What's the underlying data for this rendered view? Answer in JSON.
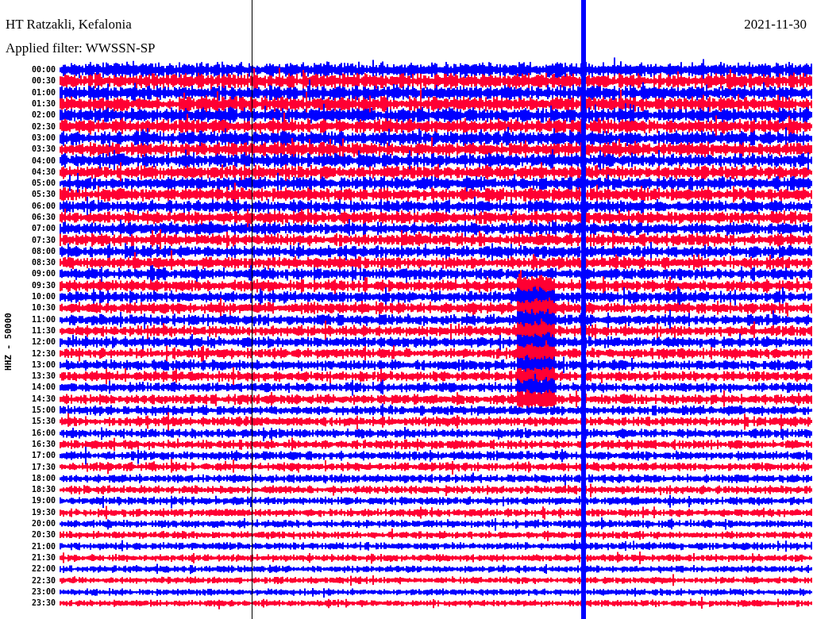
{
  "header": {
    "station": "HT Ratzakli, Kefalonia",
    "date": "2021-11-30",
    "filter": "Applied filter: WWSSN-SP"
  },
  "axis_label": "HHZ - 50000",
  "traces": [
    {
      "time": "00:00",
      "color": "#0000ff"
    },
    {
      "time": "00:30",
      "color": "#ff0033"
    },
    {
      "time": "01:00",
      "color": "#0000ff"
    },
    {
      "time": "01:30",
      "color": "#ff0033"
    },
    {
      "time": "02:00",
      "color": "#0000ff"
    },
    {
      "time": "02:30",
      "color": "#ff0033"
    },
    {
      "time": "03:00",
      "color": "#0000ff"
    },
    {
      "time": "03:30",
      "color": "#ff0033"
    },
    {
      "time": "04:00",
      "color": "#0000ff"
    },
    {
      "time": "04:30",
      "color": "#ff0033"
    },
    {
      "time": "05:00",
      "color": "#0000ff"
    },
    {
      "time": "05:30",
      "color": "#ff0033"
    },
    {
      "time": "06:00",
      "color": "#0000ff"
    },
    {
      "time": "06:30",
      "color": "#ff0033"
    },
    {
      "time": "07:00",
      "color": "#0000ff"
    },
    {
      "time": "07:30",
      "color": "#ff0033"
    },
    {
      "time": "08:00",
      "color": "#0000ff"
    },
    {
      "time": "08:30",
      "color": "#ff0033"
    },
    {
      "time": "09:00",
      "color": "#0000ff"
    },
    {
      "time": "09:30",
      "color": "#ff0033"
    },
    {
      "time": "10:00",
      "color": "#0000ff"
    },
    {
      "time": "10:30",
      "color": "#ff0033"
    },
    {
      "time": "11:00",
      "color": "#0000ff"
    },
    {
      "time": "11:30",
      "color": "#ff0033"
    },
    {
      "time": "12:00",
      "color": "#0000ff"
    },
    {
      "time": "12:30",
      "color": "#ff0033"
    },
    {
      "time": "13:00",
      "color": "#0000ff"
    },
    {
      "time": "13:30",
      "color": "#ff0033"
    },
    {
      "time": "14:00",
      "color": "#0000ff"
    },
    {
      "time": "14:30",
      "color": "#ff0033"
    },
    {
      "time": "15:00",
      "color": "#0000ff"
    },
    {
      "time": "15:30",
      "color": "#ff0033"
    },
    {
      "time": "16:00",
      "color": "#0000ff"
    },
    {
      "time": "16:30",
      "color": "#ff0033"
    },
    {
      "time": "17:00",
      "color": "#0000ff"
    },
    {
      "time": "17:30",
      "color": "#ff0033"
    },
    {
      "time": "18:00",
      "color": "#0000ff"
    },
    {
      "time": "18:30",
      "color": "#ff0033"
    },
    {
      "time": "19:00",
      "color": "#0000ff"
    },
    {
      "time": "19:30",
      "color": "#ff0033"
    },
    {
      "time": "20:00",
      "color": "#0000ff"
    },
    {
      "time": "20:30",
      "color": "#ff0033"
    },
    {
      "time": "21:00",
      "color": "#0000ff"
    },
    {
      "time": "21:30",
      "color": "#ff0033"
    },
    {
      "time": "22:00",
      "color": "#0000ff"
    },
    {
      "time": "22:30",
      "color": "#ff0033"
    },
    {
      "time": "23:00",
      "color": "#0000ff"
    },
    {
      "time": "23:30",
      "color": "#ff0033"
    }
  ]
}
